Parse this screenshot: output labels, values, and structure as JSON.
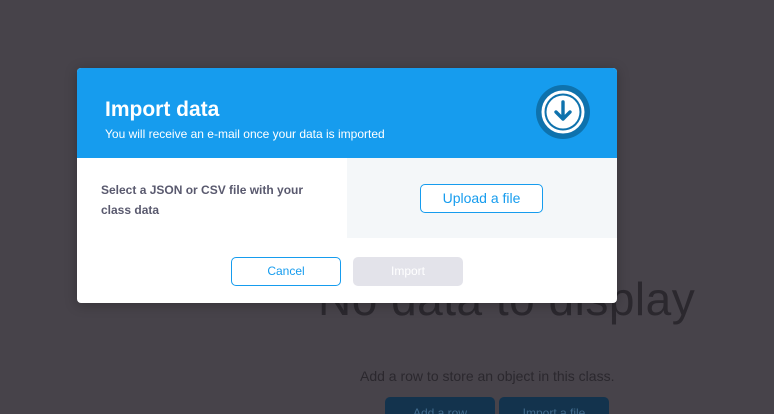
{
  "background": {
    "empty_title": "No data to display",
    "empty_subtitle": "Add a row to store an object in this class.",
    "add_row_label": "Add a row",
    "import_file_label": "Import a file"
  },
  "modal": {
    "title": "Import data",
    "subtitle": "You will receive an e-mail once your data is imported",
    "header_icon": "download-circle-icon",
    "body_label": "Select a JSON or CSV file with your class data",
    "upload_label": "Upload a file",
    "cancel_label": "Cancel",
    "import_label": "Import",
    "import_enabled": false
  },
  "colors": {
    "accent": "#169cee",
    "accent_dark": "#0e72ad",
    "overlay_bg": "#47434a",
    "disabled": "#e3e3ea"
  }
}
